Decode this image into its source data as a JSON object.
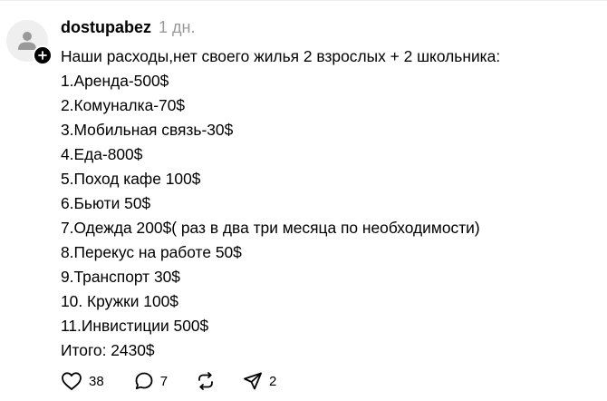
{
  "post": {
    "username": "dostupabez",
    "time": "1 дн.",
    "lines": [
      "Наши расходы,нет своего жилья 2 взрослых + 2 школьника:",
      "1.Аренда-500$",
      "2.Комуналка-70$",
      "3.Мобильная связь-30$",
      "4.Еда-800$",
      "5.Поход кафе 100$",
      "6.Бьюти 50$",
      "7.Одежда 200$( раз в два три месяца по необходимости)",
      "8.Перекус на работе 50$",
      "9.Транспорт 30$",
      "10. Кружки 100$",
      "11.Инвистиции 500$",
      "Итого: 2430$"
    ]
  },
  "actions": {
    "likes": "38",
    "replies": "7",
    "shares": "2"
  },
  "icons": {
    "avatar": "default-user-icon",
    "follow": "plus-icon",
    "like": "heart-icon",
    "reply": "speech-bubble-icon",
    "repost": "repost-arrows-icon",
    "share": "paper-plane-icon"
  },
  "colors": {
    "text": "#000000",
    "muted": "#999999",
    "avatar_bg": "#efefef",
    "divider": "#efefef"
  }
}
